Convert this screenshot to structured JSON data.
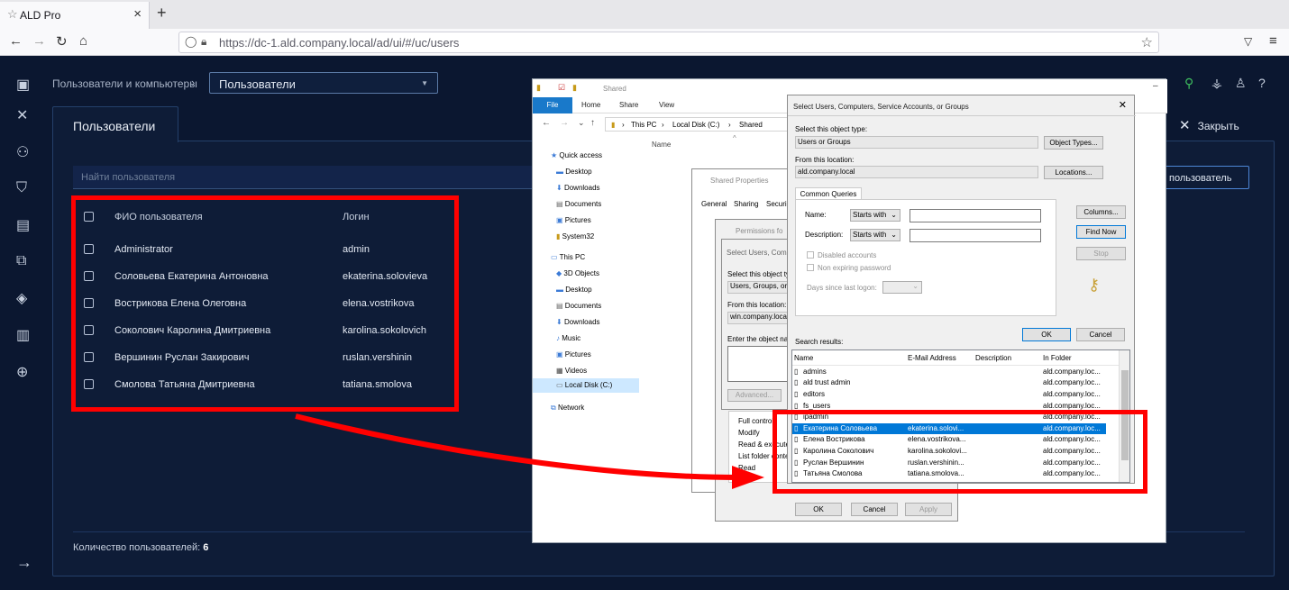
{
  "browser": {
    "tab_title": "ALD Pro",
    "url": "https://dc-1.ald.company.local/ad/ui/#/uc/users"
  },
  "app": {
    "breadcrumb": "Пользователи и компьютеры",
    "section_select": "Пользователи",
    "tab_title": "Пользователи",
    "close_label": "Закрыть",
    "search_placeholder": "Найти пользователя",
    "add_button": "пользователь",
    "columns": {
      "name": "ФИО пользователя",
      "login": "Логин"
    },
    "users": [
      {
        "name": "Administrator",
        "login": "admin"
      },
      {
        "name": "Соловьева Екатерина Антоновна",
        "login": "ekaterina.solovieva"
      },
      {
        "name": "Вострикова Елена Олеговна",
        "login": "elena.vostrikova"
      },
      {
        "name": "Соколович Каролина Дмитриевна",
        "login": "karolina.sokolovich"
      },
      {
        "name": "Вершинин Руслан Закирович",
        "login": "ruslan.vershinin"
      },
      {
        "name": "Смолова Татьяна Дмитриевна",
        "login": "tatiana.smolova"
      }
    ],
    "footer_label": "Количество пользователей:",
    "footer_count": "6"
  },
  "explorer": {
    "title": "Shared",
    "ribbon": {
      "file": "File",
      "home": "Home",
      "share": "Share",
      "view": "View"
    },
    "path": [
      "This PC",
      "Local Disk (C:)",
      "Shared"
    ],
    "column_name": "Name",
    "nav": {
      "quick_access": "Quick access",
      "desktop": "Desktop",
      "downloads": "Downloads",
      "documents": "Documents",
      "pictures": "Pictures",
      "system32": "System32",
      "this_pc": "This PC",
      "objects3d": "3D Objects",
      "desktop2": "Desktop",
      "documents2": "Documents",
      "downloads2": "Downloads",
      "music": "Music",
      "pictures2": "Pictures",
      "videos": "Videos",
      "localdisk": "Local Disk (C:)",
      "network": "Network"
    }
  },
  "properties": {
    "title": "Shared Properties",
    "tabs": {
      "general": "General",
      "sharing": "Sharing",
      "security": "Securi"
    },
    "perm_list": [
      "Full control",
      "Modify",
      "Read & execute",
      "List folder contents",
      "Read"
    ]
  },
  "permissions": {
    "title": "Permissions fo",
    "ok": "OK",
    "cancel": "Cancel",
    "apply": "Apply"
  },
  "select_small": {
    "title": "Select Users, Com",
    "obj_type_label": "Select this object ty",
    "obj_type_value": "Users, Groups, or",
    "location_label": "From this location:",
    "location_value": "win.company.local",
    "enter_label": "Enter the object na",
    "advanced": "Advanced..."
  },
  "select_dialog": {
    "title": "Select Users, Computers, Service Accounts, or Groups",
    "obj_type_label": "Select this object type:",
    "obj_type_value": "Users or Groups",
    "object_types_btn": "Object Types...",
    "location_label": "From this location:",
    "location_value": "ald.company.local",
    "locations_btn": "Locations...",
    "tab": "Common Queries",
    "name_label": "Name:",
    "desc_label": "Description:",
    "starts_with": "Starts with",
    "disabled": "Disabled accounts",
    "nonexpiring": "Non expiring password",
    "days_label": "Days since last logon:",
    "columns_btn": "Columns...",
    "find_btn": "Find Now",
    "stop_btn": "Stop",
    "ok": "OK",
    "cancel": "Cancel",
    "results_label": "Search results:",
    "results_cols": {
      "name": "Name",
      "email": "E-Mail Address",
      "desc": "Description",
      "folder": "In Folder"
    },
    "results": [
      {
        "name": "admins",
        "email": "",
        "folder": "ald.company.loc..."
      },
      {
        "name": "ald trust admin",
        "email": "",
        "folder": "ald.company.loc..."
      },
      {
        "name": "editors",
        "email": "",
        "folder": "ald.company.loc..."
      },
      {
        "name": "fs_users",
        "email": "",
        "folder": "ald.company.loc..."
      },
      {
        "name": "ipadmin",
        "email": "",
        "folder": "ald.company.loc..."
      },
      {
        "name": "Екатерина Соловьева",
        "email": "ekaterina.solovi...",
        "folder": "ald.company.loc..."
      },
      {
        "name": "Елена Вострикова",
        "email": "elena.vostrikova...",
        "folder": "ald.company.loc..."
      },
      {
        "name": "Каролина Соколович",
        "email": "karolina.sokolovi...",
        "folder": "ald.company.loc..."
      },
      {
        "name": "Руслан Вершинин",
        "email": "ruslan.vershinin...",
        "folder": "ald.company.loc..."
      },
      {
        "name": "Татьяна Смолова",
        "email": "tatiana.smolova...",
        "folder": "ald.company.loc..."
      }
    ]
  },
  "colors": {
    "annotation": "#ff0000",
    "selection": "#0078d7",
    "app_bg": "#0b1730"
  }
}
